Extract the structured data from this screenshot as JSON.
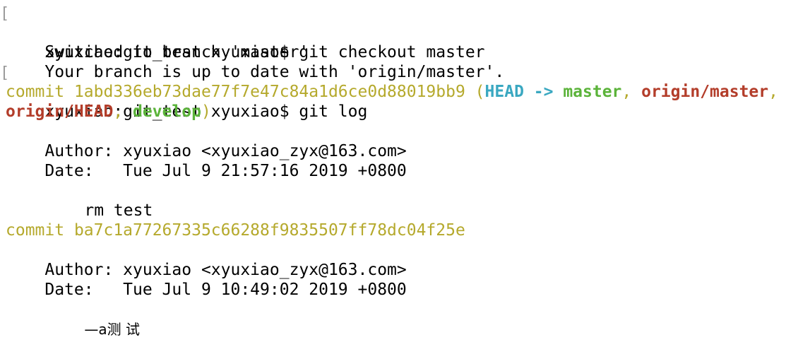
{
  "colors": {
    "commit_yellow": "#b5a92c",
    "head_cyan": "#3aa8c1",
    "branch_green": "#5bb33a",
    "remote_red": "#b33d2a",
    "text": "#000000",
    "prompt_marker": "#9a9a9a"
  },
  "terminal": {
    "prompt_marker": "[",
    "lines": {
      "cmd1": "xyuxiao:git_test xyuxiao$ git checkout master",
      "out1": "Switched to branch 'master'",
      "out2": "Your branch is up to date with 'origin/master'.",
      "cmd2": "xyuxiao:git_test xyuxiao$ git log"
    },
    "commits": [
      {
        "prefix": "commit ",
        "hash": "1abd336eb73dae77f7e47c84a1d6ce0d88019bb9",
        "refs": {
          "open": " (",
          "head": "HEAD",
          "arrow": " -> ",
          "branch": "master",
          "sep1": ", ",
          "remote1": "origin/master",
          "sep2": ",",
          "remote2": "origin/HEAD",
          "sep3": ", ",
          "branch2": "develop",
          "close": ")"
        },
        "author": "Author: xyuxiao <xyuxiao_zyx@163.com>",
        "date": "Date:   Tue Jul 9 21:57:16 2019 +0800",
        "message": "rm test"
      },
      {
        "prefix": "commit ",
        "hash": "ba7c1a77267335c66288f9835507ff78dc04f25e",
        "author": "Author: xyuxiao <xyuxiao_zyx@163.com>",
        "date": "Date:   Tue Jul 9 10:49:02 2019 +0800",
        "message": "—a测 试"
      }
    ]
  }
}
